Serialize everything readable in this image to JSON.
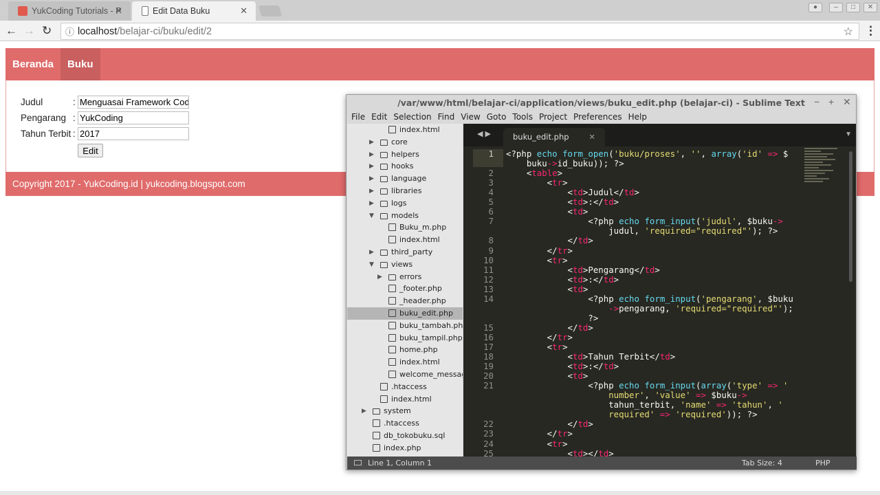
{
  "browser": {
    "tabs": [
      {
        "title": "YukCoding Tutorials - P",
        "active": false
      },
      {
        "title": "Edit Data Buku",
        "active": true
      }
    ],
    "url_host": "localhost",
    "url_path": "/belajar-ci/buku/edit/2"
  },
  "page": {
    "nav": [
      {
        "label": "Beranda",
        "active": false
      },
      {
        "label": "Buku",
        "active": true
      }
    ],
    "form": {
      "judul_label": "Judul",
      "pengarang_label": "Pengarang",
      "tahun_label": "Tahun Terbit",
      "colon": ":",
      "judul_value": "Menguasai Framework CodeIgniter",
      "pengarang_value": "YukCoding",
      "tahun_value": "2017",
      "submit_label": "Edit"
    },
    "footer": "Copyright 2017 - YukCoding.id | yukcoding.blogspot.com"
  },
  "editor": {
    "title": "/var/www/html/belajar-ci/application/views/buku_edit.php (belajar-ci) - Sublime Text",
    "menu": [
      "File",
      "Edit",
      "Selection",
      "Find",
      "View",
      "Goto",
      "Tools",
      "Project",
      "Preferences",
      "Help"
    ],
    "tree": [
      {
        "name": "index.html",
        "type": "file",
        "level": 3
      },
      {
        "name": "core",
        "type": "folder",
        "level": 2
      },
      {
        "name": "helpers",
        "type": "folder",
        "level": 2
      },
      {
        "name": "hooks",
        "type": "folder",
        "level": 2
      },
      {
        "name": "language",
        "type": "folder",
        "level": 2
      },
      {
        "name": "libraries",
        "type": "folder",
        "level": 2
      },
      {
        "name": "logs",
        "type": "folder",
        "level": 2
      },
      {
        "name": "models",
        "type": "folder",
        "level": 2,
        "open": true
      },
      {
        "name": "Buku_m.php",
        "type": "file",
        "level": 3
      },
      {
        "name": "index.html",
        "type": "file",
        "level": 3
      },
      {
        "name": "third_party",
        "type": "folder",
        "level": 2
      },
      {
        "name": "views",
        "type": "folder",
        "level": 2,
        "open": true
      },
      {
        "name": "errors",
        "type": "folder",
        "level": 3
      },
      {
        "name": "_footer.php",
        "type": "file",
        "level": 3
      },
      {
        "name": "_header.php",
        "type": "file",
        "level": 3
      },
      {
        "name": "buku_edit.php",
        "type": "file",
        "level": 3,
        "selected": true
      },
      {
        "name": "buku_tambah.php",
        "type": "file",
        "level": 3
      },
      {
        "name": "buku_tampil.php",
        "type": "file",
        "level": 3
      },
      {
        "name": "home.php",
        "type": "file",
        "level": 3
      },
      {
        "name": "index.html",
        "type": "file",
        "level": 3
      },
      {
        "name": "welcome_message.php",
        "type": "file",
        "level": 3
      },
      {
        "name": ".htaccess",
        "type": "file",
        "level": 2
      },
      {
        "name": "index.html",
        "type": "file",
        "level": 2
      },
      {
        "name": "system",
        "type": "folder",
        "level": 1
      },
      {
        "name": ".htaccess",
        "type": "file",
        "level": 1
      },
      {
        "name": "db_tokobuku.sql",
        "type": "file",
        "level": 1
      },
      {
        "name": "index.php",
        "type": "file",
        "level": 1
      }
    ],
    "file_tab": "buku_edit.php",
    "code": [
      {
        "n": "1",
        "t": [
          [
            "p",
            "<?php "
          ],
          [
            "k",
            "echo "
          ],
          [
            "k",
            "form_open"
          ],
          [
            "p",
            "("
          ],
          [
            "s",
            "'buku/proses'"
          ],
          [
            "p",
            ", "
          ],
          [
            "s",
            "''"
          ],
          [
            "p",
            ", "
          ],
          [
            "k",
            "array"
          ],
          [
            "p",
            "("
          ],
          [
            "s",
            "'id'"
          ],
          [
            "t",
            " => "
          ],
          [
            "p",
            "$"
          ]
        ]
      },
      {
        "n": "",
        "t": [
          [
            "p",
            "    buku"
          ],
          [
            "t",
            "->"
          ],
          [
            "p",
            "id_buku)); ?>"
          ]
        ]
      },
      {
        "n": "2",
        "t": [
          [
            "p",
            "    <"
          ],
          [
            "t",
            "table"
          ],
          [
            "p",
            ">"
          ]
        ]
      },
      {
        "n": "3",
        "t": [
          [
            "p",
            "        <"
          ],
          [
            "t",
            "tr"
          ],
          [
            "p",
            ">"
          ]
        ]
      },
      {
        "n": "4",
        "t": [
          [
            "p",
            "            <"
          ],
          [
            "t",
            "td"
          ],
          [
            "p",
            ">Judul</"
          ],
          [
            "t",
            "td"
          ],
          [
            "p",
            ">"
          ]
        ]
      },
      {
        "n": "5",
        "t": [
          [
            "p",
            "            <"
          ],
          [
            "t",
            "td"
          ],
          [
            "p",
            ">:</"
          ],
          [
            "t",
            "td"
          ],
          [
            "p",
            ">"
          ]
        ]
      },
      {
        "n": "6",
        "t": [
          [
            "p",
            "            <"
          ],
          [
            "t",
            "td"
          ],
          [
            "p",
            ">"
          ]
        ]
      },
      {
        "n": "7",
        "t": [
          [
            "p",
            "                <?php "
          ],
          [
            "k",
            "echo "
          ],
          [
            "k",
            "form_input"
          ],
          [
            "p",
            "("
          ],
          [
            "s",
            "'judul'"
          ],
          [
            "p",
            ", $buku"
          ],
          [
            "t",
            "->"
          ]
        ]
      },
      {
        "n": "",
        "t": [
          [
            "p",
            "                    judul, "
          ],
          [
            "s",
            "'required=\"required\"'"
          ],
          [
            "p",
            "); ?>"
          ]
        ]
      },
      {
        "n": "8",
        "t": [
          [
            "p",
            "            </"
          ],
          [
            "t",
            "td"
          ],
          [
            "p",
            ">"
          ]
        ]
      },
      {
        "n": "9",
        "t": [
          [
            "p",
            "        </"
          ],
          [
            "t",
            "tr"
          ],
          [
            "p",
            ">"
          ]
        ]
      },
      {
        "n": "10",
        "t": [
          [
            "p",
            "        <"
          ],
          [
            "t",
            "tr"
          ],
          [
            "p",
            ">"
          ]
        ]
      },
      {
        "n": "11",
        "t": [
          [
            "p",
            "            <"
          ],
          [
            "t",
            "td"
          ],
          [
            "p",
            ">Pengarang</"
          ],
          [
            "t",
            "td"
          ],
          [
            "p",
            ">"
          ]
        ]
      },
      {
        "n": "12",
        "t": [
          [
            "p",
            "            <"
          ],
          [
            "t",
            "td"
          ],
          [
            "p",
            ">:</"
          ],
          [
            "t",
            "td"
          ],
          [
            "p",
            ">"
          ]
        ]
      },
      {
        "n": "13",
        "t": [
          [
            "p",
            "            <"
          ],
          [
            "t",
            "td"
          ],
          [
            "p",
            ">"
          ]
        ]
      },
      {
        "n": "14",
        "t": [
          [
            "p",
            "                <?php "
          ],
          [
            "k",
            "echo "
          ],
          [
            "k",
            "form_input"
          ],
          [
            "p",
            "("
          ],
          [
            "s",
            "'pengarang'"
          ],
          [
            "p",
            ", $buku"
          ]
        ]
      },
      {
        "n": "",
        "t": [
          [
            "p",
            "                    "
          ],
          [
            "t",
            "->"
          ],
          [
            "p",
            "pengarang, "
          ],
          [
            "s",
            "'required=\"required\"'"
          ],
          [
            "p",
            ");"
          ]
        ]
      },
      {
        "n": "",
        "t": [
          [
            "p",
            "                ?>"
          ]
        ]
      },
      {
        "n": "15",
        "t": [
          [
            "p",
            "            </"
          ],
          [
            "t",
            "td"
          ],
          [
            "p",
            ">"
          ]
        ]
      },
      {
        "n": "16",
        "t": [
          [
            "p",
            "        </"
          ],
          [
            "t",
            "tr"
          ],
          [
            "p",
            ">"
          ]
        ]
      },
      {
        "n": "17",
        "t": [
          [
            "p",
            "        <"
          ],
          [
            "t",
            "tr"
          ],
          [
            "p",
            ">"
          ]
        ]
      },
      {
        "n": "18",
        "t": [
          [
            "p",
            "            <"
          ],
          [
            "t",
            "td"
          ],
          [
            "p",
            ">Tahun Terbit</"
          ],
          [
            "t",
            "td"
          ],
          [
            "p",
            ">"
          ]
        ]
      },
      {
        "n": "19",
        "t": [
          [
            "p",
            "            <"
          ],
          [
            "t",
            "td"
          ],
          [
            "p",
            ">:</"
          ],
          [
            "t",
            "td"
          ],
          [
            "p",
            ">"
          ]
        ]
      },
      {
        "n": "20",
        "t": [
          [
            "p",
            "            <"
          ],
          [
            "t",
            "td"
          ],
          [
            "p",
            ">"
          ]
        ]
      },
      {
        "n": "21",
        "t": [
          [
            "p",
            "                <?php "
          ],
          [
            "k",
            "echo "
          ],
          [
            "k",
            "form_input"
          ],
          [
            "p",
            "("
          ],
          [
            "k",
            "array"
          ],
          [
            "p",
            "("
          ],
          [
            "s",
            "'type'"
          ],
          [
            "t",
            " => "
          ],
          [
            "s",
            "'"
          ]
        ]
      },
      {
        "n": "",
        "t": [
          [
            "s",
            "                    number'"
          ],
          [
            "p",
            ", "
          ],
          [
            "s",
            "'value'"
          ],
          [
            "t",
            " => "
          ],
          [
            "p",
            "$buku"
          ],
          [
            "t",
            "->"
          ]
        ]
      },
      {
        "n": "",
        "t": [
          [
            "p",
            "                    tahun_terbit, "
          ],
          [
            "s",
            "'name'"
          ],
          [
            "t",
            " => "
          ],
          [
            "s",
            "'tahun'"
          ],
          [
            "p",
            ", "
          ],
          [
            "s",
            "'"
          ]
        ]
      },
      {
        "n": "",
        "t": [
          [
            "s",
            "                    required'"
          ],
          [
            "t",
            " => "
          ],
          [
            "s",
            "'required'"
          ],
          [
            "p",
            ")); ?>"
          ]
        ]
      },
      {
        "n": "22",
        "t": [
          [
            "p",
            "            </"
          ],
          [
            "t",
            "td"
          ],
          [
            "p",
            ">"
          ]
        ]
      },
      {
        "n": "23",
        "t": [
          [
            "p",
            "        </"
          ],
          [
            "t",
            "tr"
          ],
          [
            "p",
            ">"
          ]
        ]
      },
      {
        "n": "24",
        "t": [
          [
            "p",
            "        <"
          ],
          [
            "t",
            "tr"
          ],
          [
            "p",
            ">"
          ]
        ]
      },
      {
        "n": "25",
        "t": [
          [
            "p",
            "            <"
          ],
          [
            "t",
            "td"
          ],
          [
            "p",
            "></"
          ],
          [
            "t",
            "td"
          ],
          [
            "p",
            ">"
          ]
        ]
      }
    ],
    "status": {
      "position": "Line 1, Column 1",
      "tab_size": "Tab Size: 4",
      "syntax": "PHP"
    }
  }
}
